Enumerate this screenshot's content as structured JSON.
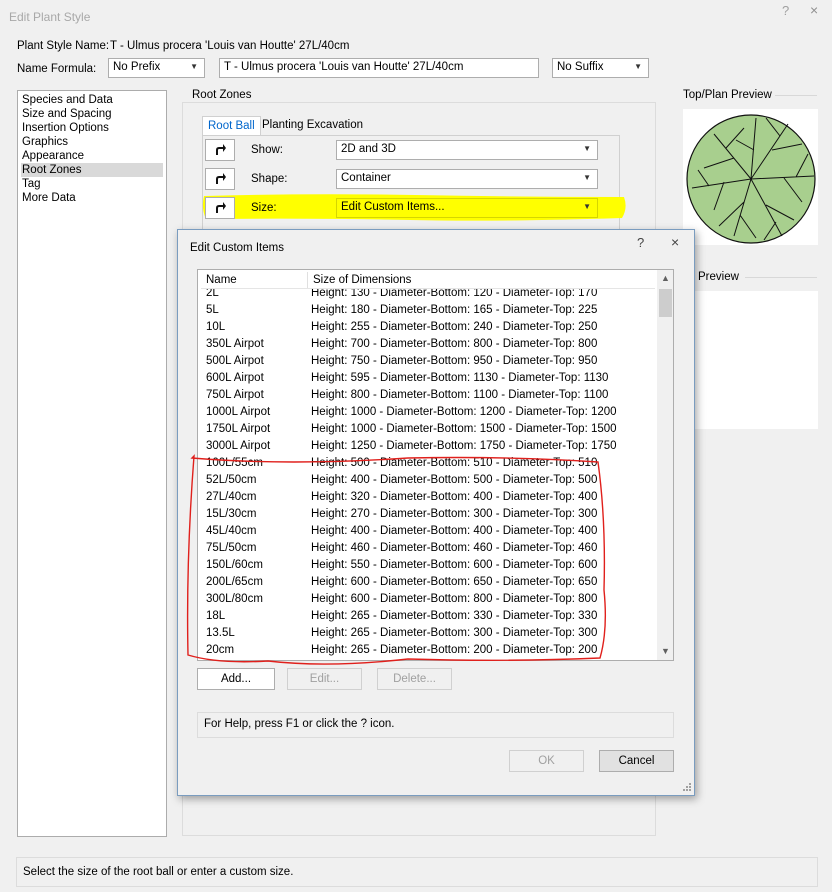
{
  "window": {
    "title": "Edit Plant Style",
    "help_glyph": "?",
    "close_glyph": "×"
  },
  "plant_style": {
    "name_label": "Plant Style Name:",
    "name_value": "T - Ulmus procera 'Louis van Houtte' 27L/40cm",
    "formula_label": "Name Formula:",
    "prefix_value": "No Prefix",
    "formula_value": "T - Ulmus procera 'Louis van Houtte' 27L/40cm",
    "suffix_value": "No Suffix"
  },
  "nav": {
    "items": [
      "Species and Data",
      "Size and Spacing",
      "Insertion Options",
      "Graphics",
      "Appearance",
      "Root Zones",
      "Tag",
      "More Data"
    ],
    "selected": "Root Zones"
  },
  "root_zones": {
    "group_title": "Root Zones",
    "tabs": [
      "Root Ball",
      "Planting Excavation"
    ],
    "active_tab": "Root Ball",
    "show_label": "Show:",
    "show_value": "2D and 3D",
    "shape_label": "Shape:",
    "shape_value": "Container",
    "size_label": "Size:",
    "size_value": "Edit Custom Items...",
    "highlight_color": "#ffff00"
  },
  "preview": {
    "top_plan_title": "Top/Plan Preview",
    "second_title": "Preview",
    "tree_fill": "#a8cf8e"
  },
  "dialog": {
    "title": "Edit Custom Items",
    "help_glyph": "?",
    "close_glyph": "×",
    "columns": [
      "Name",
      "Size of Dimensions"
    ],
    "rows": [
      {
        "name": "2L",
        "size": "Height: 130 - Diameter-Bottom: 120 - Diameter-Top: 170"
      },
      {
        "name": "5L",
        "size": "Height: 180 - Diameter-Bottom: 165 - Diameter-Top: 225"
      },
      {
        "name": "10L",
        "size": "Height: 255 - Diameter-Bottom: 240 - Diameter-Top: 250"
      },
      {
        "name": "350L Airpot",
        "size": "Height: 700 - Diameter-Bottom: 800 - Diameter-Top: 800"
      },
      {
        "name": "500L Airpot",
        "size": "Height: 750 - Diameter-Bottom: 950 - Diameter-Top: 950"
      },
      {
        "name": "600L Airpot",
        "size": "Height: 595 - Diameter-Bottom: 1130 - Diameter-Top: 1130"
      },
      {
        "name": "750L Airpot",
        "size": "Height: 800 - Diameter-Bottom: 1100 - Diameter-Top: 1100"
      },
      {
        "name": "1000L Airpot",
        "size": "Height: 1000 - Diameter-Bottom: 1200 - Diameter-Top: 1200"
      },
      {
        "name": "1750L Airpot",
        "size": "Height: 1000 - Diameter-Bottom: 1500 - Diameter-Top: 1500"
      },
      {
        "name": "3000L Airpot",
        "size": "Height: 1250 - Diameter-Bottom: 1750 - Diameter-Top: 1750"
      },
      {
        "name": "100L/55cm",
        "size": "Height: 500 - Diameter-Bottom: 510 - Diameter-Top: 510"
      },
      {
        "name": "52L/50cm",
        "size": "Height: 400 - Diameter-Bottom: 500 - Diameter-Top: 500"
      },
      {
        "name": "27L/40cm",
        "size": "Height: 320 - Diameter-Bottom: 400 - Diameter-Top: 400"
      },
      {
        "name": "15L/30cm",
        "size": "Height: 270 - Diameter-Bottom: 300 - Diameter-Top: 300"
      },
      {
        "name": "45L/40cm",
        "size": "Height: 400 - Diameter-Bottom: 400 - Diameter-Top: 400"
      },
      {
        "name": "75L/50cm",
        "size": "Height: 460 - Diameter-Bottom: 460 - Diameter-Top: 460"
      },
      {
        "name": "150L/60cm",
        "size": "Height: 550 - Diameter-Bottom: 600 - Diameter-Top: 600"
      },
      {
        "name": "200L/65cm",
        "size": "Height: 600 - Diameter-Bottom: 650 - Diameter-Top: 650"
      },
      {
        "name": "300L/80cm",
        "size": "Height: 600 - Diameter-Bottom: 800 - Diameter-Top: 800"
      },
      {
        "name": "18L",
        "size": "Height: 265 - Diameter-Bottom: 330 - Diameter-Top: 330"
      },
      {
        "name": "13.5L",
        "size": "Height: 265 - Diameter-Bottom: 300 - Diameter-Top: 300"
      },
      {
        "name": "20cm",
        "size": "Height: 265 - Diameter-Bottom: 200 - Diameter-Top: 200"
      }
    ],
    "add_label": "Add...",
    "edit_label": "Edit...",
    "delete_label": "Delete...",
    "help_text": "For Help, press F1 or click the ? icon.",
    "ok_label": "OK",
    "cancel_label": "Cancel",
    "annotation_color": "#e0201c"
  },
  "status": {
    "text": "Select the size of the root ball or enter a custom size."
  }
}
